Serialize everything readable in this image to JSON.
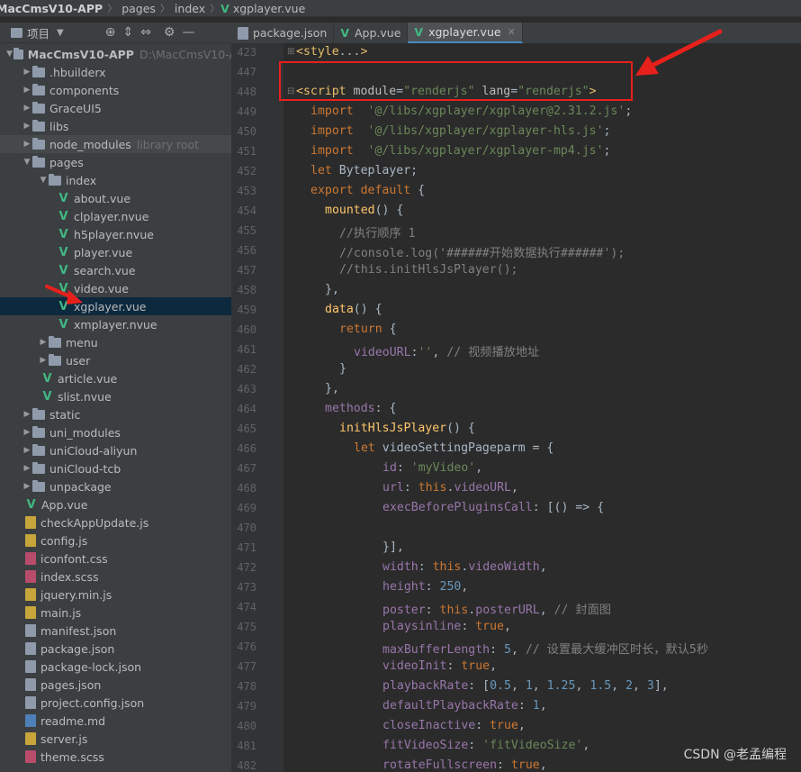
{
  "breadcrumb": [
    "MacCmsV10-APP",
    "pages",
    "index",
    "xgplayer.vue"
  ],
  "project_panel": {
    "title": "项目"
  },
  "tabs": [
    {
      "label": "package.json",
      "icon": "json-file-icon",
      "active": false
    },
    {
      "label": "App.vue",
      "icon": "vue-file-icon",
      "active": false
    },
    {
      "label": "xgplayer.vue",
      "icon": "vue-file-icon",
      "active": true
    }
  ],
  "tree": [
    {
      "label": "MacCmsV10-APP",
      "hint": "D:\\MacCmsV10-A",
      "type": "folder",
      "depth": 0,
      "open": true
    },
    {
      "label": ".hbuilderx",
      "type": "folder",
      "depth": 1,
      "open": false
    },
    {
      "label": "components",
      "type": "folder",
      "depth": 1,
      "open": false
    },
    {
      "label": "GraceUI5",
      "type": "folder",
      "depth": 1,
      "open": false
    },
    {
      "label": "libs",
      "type": "folder",
      "depth": 1,
      "open": false
    },
    {
      "label": "node_modules",
      "hint": "library root",
      "type": "folder",
      "depth": 1,
      "open": false,
      "hl": true
    },
    {
      "label": "pages",
      "type": "folder",
      "depth": 1,
      "open": true
    },
    {
      "label": "index",
      "type": "folder",
      "depth": 2,
      "open": true
    },
    {
      "label": "about.vue",
      "type": "vue",
      "depth": 3
    },
    {
      "label": "clplayer.nvue",
      "type": "vue",
      "depth": 3
    },
    {
      "label": "h5player.nvue",
      "type": "vue",
      "depth": 3
    },
    {
      "label": "player.vue",
      "type": "vue",
      "depth": 3
    },
    {
      "label": "search.vue",
      "type": "vue",
      "depth": 3
    },
    {
      "label": "video.vue",
      "type": "vue",
      "depth": 3
    },
    {
      "label": "xgplayer.vue",
      "type": "vue",
      "depth": 3,
      "selected": true
    },
    {
      "label": "xmplayer.nvue",
      "type": "vue",
      "depth": 3
    },
    {
      "label": "menu",
      "type": "folder",
      "depth": 2,
      "open": false
    },
    {
      "label": "user",
      "type": "folder",
      "depth": 2,
      "open": false
    },
    {
      "label": "article.vue",
      "type": "vue",
      "depth": 2
    },
    {
      "label": "slist.nvue",
      "type": "vue",
      "depth": 2
    },
    {
      "label": "static",
      "type": "folder",
      "depth": 1,
      "open": false
    },
    {
      "label": "uni_modules",
      "type": "folder",
      "depth": 1,
      "open": false
    },
    {
      "label": "uniCloud-aliyun",
      "type": "folder",
      "depth": 1,
      "open": false
    },
    {
      "label": "uniCloud-tcb",
      "type": "folder",
      "depth": 1,
      "open": false
    },
    {
      "label": "unpackage",
      "type": "folder",
      "depth": 1,
      "open": false
    },
    {
      "label": "App.vue",
      "type": "vue",
      "depth": 1
    },
    {
      "label": "checkAppUpdate.js",
      "type": "js",
      "depth": 1
    },
    {
      "label": "config.js",
      "type": "js",
      "depth": 1
    },
    {
      "label": "iconfont.css",
      "type": "css",
      "depth": 1
    },
    {
      "label": "index.scss",
      "type": "css",
      "depth": 1
    },
    {
      "label": "jquery.min.js",
      "type": "js",
      "depth": 1
    },
    {
      "label": "main.js",
      "type": "js",
      "depth": 1
    },
    {
      "label": "manifest.json",
      "type": "json",
      "depth": 1
    },
    {
      "label": "package.json",
      "type": "json",
      "depth": 1
    },
    {
      "label": "package-lock.json",
      "type": "json",
      "depth": 1
    },
    {
      "label": "pages.json",
      "type": "json",
      "depth": 1
    },
    {
      "label": "project.config.json",
      "type": "json",
      "depth": 1
    },
    {
      "label": "readme.md",
      "type": "md",
      "depth": 1
    },
    {
      "label": "server.js",
      "type": "js",
      "depth": 1
    },
    {
      "label": "theme.scss",
      "type": "css",
      "depth": 1
    }
  ],
  "code_lines": [
    {
      "n": "423",
      "indent": 0,
      "fold": "+",
      "tokens": [
        [
          "tag",
          "<style"
        ],
        [
          "plain",
          "..."
        ],
        [
          "tag",
          ">"
        ]
      ]
    },
    {
      "n": "447",
      "indent": 0,
      "tokens": []
    },
    {
      "n": "448",
      "indent": 0,
      "fold": "-",
      "tokens": [
        [
          "tag",
          "<script"
        ],
        [
          "plain",
          " "
        ],
        [
          "attr",
          "module"
        ],
        [
          "plain",
          "="
        ],
        [
          "str",
          "\"renderjs\""
        ],
        [
          "plain",
          " "
        ],
        [
          "attr",
          "lang"
        ],
        [
          "plain",
          "="
        ],
        [
          "str",
          "\"renderjs\""
        ],
        [
          "tag",
          ">"
        ]
      ]
    },
    {
      "n": "449",
      "indent": 1,
      "tokens": [
        [
          "kw",
          "import"
        ],
        [
          "plain",
          "  "
        ],
        [
          "str",
          "'@/libs/xgplayer/xgplayer@2.31.2.js'"
        ],
        [
          "plain",
          ";"
        ]
      ]
    },
    {
      "n": "450",
      "indent": 1,
      "tokens": [
        [
          "kw",
          "import"
        ],
        [
          "plain",
          "  "
        ],
        [
          "str",
          "'@/libs/xgplayer/xgplayer-hls.js'"
        ],
        [
          "plain",
          ";"
        ]
      ]
    },
    {
      "n": "451",
      "indent": 1,
      "tokens": [
        [
          "kw",
          "import"
        ],
        [
          "plain",
          "  "
        ],
        [
          "str",
          "'@/libs/xgplayer/xgplayer-mp4.js'"
        ],
        [
          "plain",
          ";"
        ]
      ]
    },
    {
      "n": "452",
      "indent": 1,
      "tokens": [
        [
          "kw",
          "let"
        ],
        [
          "plain",
          " Byteplayer;"
        ]
      ]
    },
    {
      "n": "453",
      "indent": 1,
      "tokens": [
        [
          "kw",
          "export default"
        ],
        [
          "plain",
          " {"
        ]
      ]
    },
    {
      "n": "454",
      "indent": 2,
      "tokens": [
        [
          "fn",
          "mounted"
        ],
        [
          "plain",
          "() {"
        ]
      ]
    },
    {
      "n": "455",
      "indent": 3,
      "tokens": [
        [
          "cmt",
          "//执行顺序 1"
        ]
      ]
    },
    {
      "n": "456",
      "indent": 3,
      "tokens": [
        [
          "cmt",
          "//console.log('######开始数据执行######');"
        ]
      ]
    },
    {
      "n": "457",
      "indent": 3,
      "tokens": [
        [
          "cmt",
          "//this.initHlsJsPlayer();"
        ]
      ]
    },
    {
      "n": "458",
      "indent": 2,
      "tokens": [
        [
          "plain",
          "},"
        ]
      ]
    },
    {
      "n": "459",
      "indent": 2,
      "tokens": [
        [
          "fn",
          "data"
        ],
        [
          "plain",
          "() {"
        ]
      ]
    },
    {
      "n": "460",
      "indent": 3,
      "tokens": [
        [
          "kw",
          "return"
        ],
        [
          "plain",
          " {"
        ]
      ]
    },
    {
      "n": "461",
      "indent": 4,
      "tokens": [
        [
          "prop",
          "videoURL"
        ],
        [
          "plain",
          ":"
        ],
        [
          "str",
          "''"
        ],
        [
          "plain",
          ", "
        ],
        [
          "cmt",
          "// 视频播放地址"
        ]
      ]
    },
    {
      "n": "462",
      "indent": 3,
      "tokens": [
        [
          "plain",
          "}"
        ]
      ]
    },
    {
      "n": "463",
      "indent": 2,
      "tokens": [
        [
          "plain",
          "},"
        ]
      ]
    },
    {
      "n": "464",
      "indent": 2,
      "tokens": [
        [
          "prop",
          "methods"
        ],
        [
          "plain",
          ": {"
        ]
      ]
    },
    {
      "n": "465",
      "indent": 3,
      "tokens": [
        [
          "fn",
          "initHlsJsPlayer"
        ],
        [
          "plain",
          "() {"
        ]
      ]
    },
    {
      "n": "466",
      "indent": 4,
      "tokens": [
        [
          "kw",
          "let"
        ],
        [
          "plain",
          " videoSettingPageparm = {"
        ]
      ]
    },
    {
      "n": "467",
      "indent": 6,
      "tokens": [
        [
          "prop",
          "id"
        ],
        [
          "plain",
          ": "
        ],
        [
          "str",
          "'myVideo'"
        ],
        [
          "plain",
          ","
        ]
      ]
    },
    {
      "n": "468",
      "indent": 6,
      "tokens": [
        [
          "prop",
          "url"
        ],
        [
          "plain",
          ": "
        ],
        [
          "kw",
          "this"
        ],
        [
          "plain",
          "."
        ],
        [
          "prop",
          "videoURL"
        ],
        [
          "plain",
          ","
        ]
      ]
    },
    {
      "n": "469",
      "indent": 6,
      "tokens": [
        [
          "prop",
          "execBeforePluginsCall"
        ],
        [
          "plain",
          ": [() => {"
        ]
      ]
    },
    {
      "n": "470",
      "indent": 0,
      "tokens": []
    },
    {
      "n": "471",
      "indent": 6,
      "tokens": [
        [
          "plain",
          "}],"
        ]
      ]
    },
    {
      "n": "472",
      "indent": 6,
      "tokens": [
        [
          "prop",
          "width"
        ],
        [
          "plain",
          ": "
        ],
        [
          "kw",
          "this"
        ],
        [
          "plain",
          "."
        ],
        [
          "prop",
          "videoWidth"
        ],
        [
          "plain",
          ","
        ]
      ]
    },
    {
      "n": "473",
      "indent": 6,
      "tokens": [
        [
          "prop",
          "height"
        ],
        [
          "plain",
          ": "
        ],
        [
          "num",
          "250"
        ],
        [
          "plain",
          ","
        ]
      ]
    },
    {
      "n": "474",
      "indent": 6,
      "tokens": [
        [
          "prop",
          "poster"
        ],
        [
          "plain",
          ": "
        ],
        [
          "kw",
          "this"
        ],
        [
          "plain",
          "."
        ],
        [
          "prop",
          "posterURL"
        ],
        [
          "plain",
          ", "
        ],
        [
          "cmt",
          "// 封面图"
        ]
      ]
    },
    {
      "n": "475",
      "indent": 6,
      "tokens": [
        [
          "prop",
          "playsinline"
        ],
        [
          "plain",
          ": "
        ],
        [
          "kw",
          "true"
        ],
        [
          "plain",
          ","
        ]
      ]
    },
    {
      "n": "476",
      "indent": 6,
      "tokens": [
        [
          "prop",
          "maxBufferLength"
        ],
        [
          "plain",
          ": "
        ],
        [
          "num",
          "5"
        ],
        [
          "plain",
          ", "
        ],
        [
          "cmt",
          "// 设置最大缓冲区时长，默认5秒"
        ]
      ]
    },
    {
      "n": "477",
      "indent": 6,
      "tokens": [
        [
          "prop",
          "videoInit"
        ],
        [
          "plain",
          ": "
        ],
        [
          "kw",
          "true"
        ],
        [
          "plain",
          ","
        ]
      ]
    },
    {
      "n": "478",
      "indent": 6,
      "tokens": [
        [
          "prop",
          "playbackRate"
        ],
        [
          "plain",
          ": ["
        ],
        [
          "num",
          "0.5"
        ],
        [
          "plain",
          ", "
        ],
        [
          "num",
          "1"
        ],
        [
          "plain",
          ", "
        ],
        [
          "num",
          "1.25"
        ],
        [
          "plain",
          ", "
        ],
        [
          "num",
          "1.5"
        ],
        [
          "plain",
          ", "
        ],
        [
          "num",
          "2"
        ],
        [
          "plain",
          ", "
        ],
        [
          "num",
          "3"
        ],
        [
          "plain",
          "],"
        ]
      ]
    },
    {
      "n": "479",
      "indent": 6,
      "tokens": [
        [
          "prop",
          "defaultPlaybackRate"
        ],
        [
          "plain",
          ": "
        ],
        [
          "num",
          "1"
        ],
        [
          "plain",
          ","
        ]
      ]
    },
    {
      "n": "480",
      "indent": 6,
      "tokens": [
        [
          "prop",
          "closeInactive"
        ],
        [
          "plain",
          ": "
        ],
        [
          "kw",
          "true"
        ],
        [
          "plain",
          ","
        ]
      ]
    },
    {
      "n": "481",
      "indent": 6,
      "tokens": [
        [
          "prop",
          "fitVideoSize"
        ],
        [
          "plain",
          ": "
        ],
        [
          "str",
          "'fitVideoSize'"
        ],
        [
          "plain",
          ","
        ]
      ]
    },
    {
      "n": "482",
      "indent": 6,
      "tokens": [
        [
          "prop",
          "rotateFullscreen"
        ],
        [
          "plain",
          ": "
        ],
        [
          "kw",
          "true"
        ],
        [
          "plain",
          ","
        ]
      ]
    }
  ],
  "watermark": "CSDN @老孟编程",
  "colors": {
    "highlight_box": "#e8201c",
    "vue_green": "#41b883",
    "selection": "#0d293e"
  }
}
